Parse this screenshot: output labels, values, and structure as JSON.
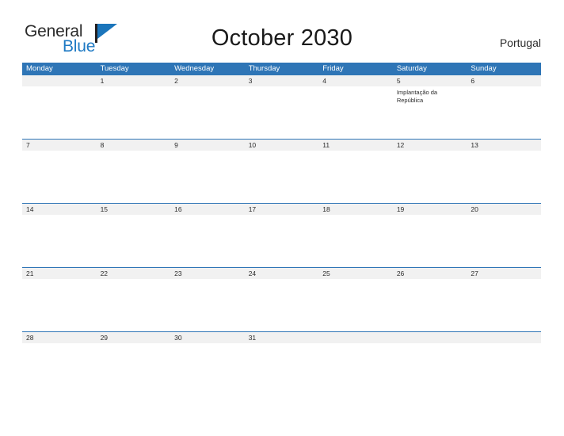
{
  "brand": {
    "name_part1": "General",
    "name_part2": "Blue",
    "flag_icon": "flag-triangle-icon",
    "colors": {
      "general_text": "#2b2b2b",
      "blue_text": "#1f7ac4",
      "flag": "#1b75bb"
    }
  },
  "header": {
    "title": "October 2030",
    "region": "Portugal"
  },
  "theme": {
    "header_blue": "#2e75b6",
    "row_rule_blue": "#2e75b6",
    "date_band_gray": "#f1f1f1",
    "page_background": "#ffffff",
    "text_dark": "#2b2b2b"
  },
  "calendar": {
    "weekdays": [
      "Monday",
      "Tuesday",
      "Wednesday",
      "Thursday",
      "Friday",
      "Saturday",
      "Sunday"
    ],
    "weeks": [
      [
        {
          "day": ""
        },
        {
          "day": "1"
        },
        {
          "day": "2"
        },
        {
          "day": "3"
        },
        {
          "day": "4"
        },
        {
          "day": "5",
          "event": "Implantação da República"
        },
        {
          "day": "6"
        }
      ],
      [
        {
          "day": "7"
        },
        {
          "day": "8"
        },
        {
          "day": "9"
        },
        {
          "day": "10"
        },
        {
          "day": "11"
        },
        {
          "day": "12"
        },
        {
          "day": "13"
        }
      ],
      [
        {
          "day": "14"
        },
        {
          "day": "15"
        },
        {
          "day": "16"
        },
        {
          "day": "17"
        },
        {
          "day": "18"
        },
        {
          "day": "19"
        },
        {
          "day": "20"
        }
      ],
      [
        {
          "day": "21"
        },
        {
          "day": "22"
        },
        {
          "day": "23"
        },
        {
          "day": "24"
        },
        {
          "day": "25"
        },
        {
          "day": "26"
        },
        {
          "day": "27"
        }
      ],
      [
        {
          "day": "28"
        },
        {
          "day": "29"
        },
        {
          "day": "30"
        },
        {
          "day": "31"
        },
        {
          "day": ""
        },
        {
          "day": ""
        },
        {
          "day": ""
        }
      ]
    ]
  }
}
